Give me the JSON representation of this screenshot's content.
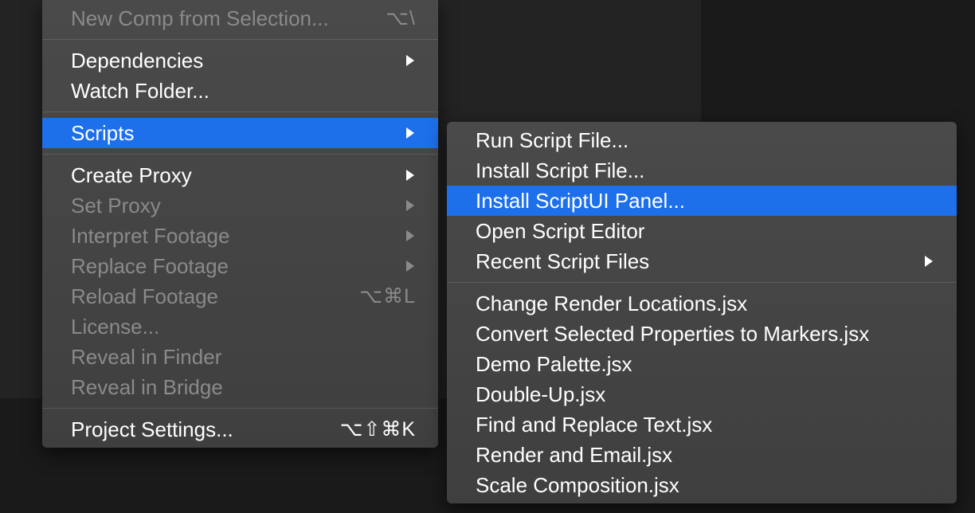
{
  "mainMenu": {
    "items": [
      {
        "label": "New Comp from Selection...",
        "shortcut": "⌥\\",
        "disabled": true,
        "submenu": false,
        "highlighted": false
      },
      {
        "separator": true
      },
      {
        "label": "Dependencies",
        "shortcut": "",
        "disabled": false,
        "submenu": true,
        "highlighted": false
      },
      {
        "label": "Watch Folder...",
        "shortcut": "",
        "disabled": false,
        "submenu": false,
        "highlighted": false
      },
      {
        "separator": true
      },
      {
        "label": "Scripts",
        "shortcut": "",
        "disabled": false,
        "submenu": true,
        "highlighted": true
      },
      {
        "separator": true
      },
      {
        "label": "Create Proxy",
        "shortcut": "",
        "disabled": false,
        "submenu": true,
        "highlighted": false
      },
      {
        "label": "Set Proxy",
        "shortcut": "",
        "disabled": true,
        "submenu": true,
        "highlighted": false
      },
      {
        "label": "Interpret Footage",
        "shortcut": "",
        "disabled": true,
        "submenu": true,
        "highlighted": false
      },
      {
        "label": "Replace Footage",
        "shortcut": "",
        "disabled": true,
        "submenu": true,
        "highlighted": false
      },
      {
        "label": "Reload Footage",
        "shortcut": "⌥⌘L",
        "disabled": true,
        "submenu": false,
        "highlighted": false
      },
      {
        "label": "License...",
        "shortcut": "",
        "disabled": true,
        "submenu": false,
        "highlighted": false
      },
      {
        "label": "Reveal in Finder",
        "shortcut": "",
        "disabled": true,
        "submenu": false,
        "highlighted": false
      },
      {
        "label": "Reveal in Bridge",
        "shortcut": "",
        "disabled": true,
        "submenu": false,
        "highlighted": false
      },
      {
        "separator": true
      },
      {
        "label": "Project Settings...",
        "shortcut": "⌥⇧⌘K",
        "disabled": false,
        "submenu": false,
        "highlighted": false
      }
    ]
  },
  "subMenu": {
    "items": [
      {
        "label": "Run Script File...",
        "shortcut": "",
        "disabled": false,
        "submenu": false,
        "highlighted": false
      },
      {
        "label": "Install Script File...",
        "shortcut": "",
        "disabled": false,
        "submenu": false,
        "highlighted": false
      },
      {
        "label": "Install ScriptUI Panel...",
        "shortcut": "",
        "disabled": false,
        "submenu": false,
        "highlighted": true
      },
      {
        "label": "Open Script Editor",
        "shortcut": "",
        "disabled": false,
        "submenu": false,
        "highlighted": false
      },
      {
        "label": "Recent Script Files",
        "shortcut": "",
        "disabled": false,
        "submenu": true,
        "highlighted": false
      },
      {
        "separator": true
      },
      {
        "label": "Change Render Locations.jsx",
        "shortcut": "",
        "disabled": false,
        "submenu": false,
        "highlighted": false
      },
      {
        "label": "Convert Selected Properties to Markers.jsx",
        "shortcut": "",
        "disabled": false,
        "submenu": false,
        "highlighted": false
      },
      {
        "label": "Demo Palette.jsx",
        "shortcut": "",
        "disabled": false,
        "submenu": false,
        "highlighted": false
      },
      {
        "label": "Double-Up.jsx",
        "shortcut": "",
        "disabled": false,
        "submenu": false,
        "highlighted": false
      },
      {
        "label": "Find and Replace Text.jsx",
        "shortcut": "",
        "disabled": false,
        "submenu": false,
        "highlighted": false
      },
      {
        "label": "Render and Email.jsx",
        "shortcut": "",
        "disabled": false,
        "submenu": false,
        "highlighted": false
      },
      {
        "label": "Scale Composition.jsx",
        "shortcut": "",
        "disabled": false,
        "submenu": false,
        "highlighted": false
      }
    ]
  }
}
